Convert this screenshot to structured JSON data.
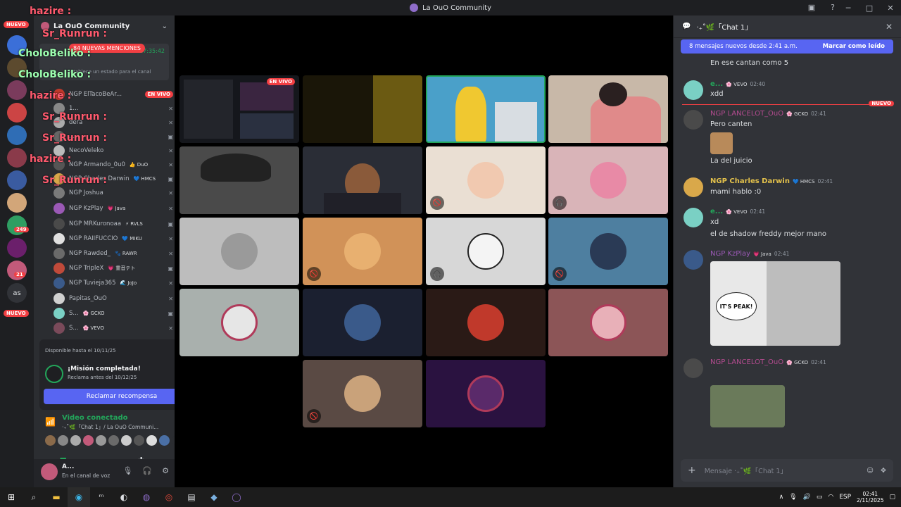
{
  "window": {
    "title": "La OuO Community"
  },
  "overlays": [
    {
      "text": "hazire :",
      "color": "red"
    },
    {
      "text": "Sr_Runrun :",
      "color": "red"
    },
    {
      "text": "CholoBeliko :",
      "color": "green"
    },
    {
      "text": "CholoBeliko :",
      "color": "green"
    },
    {
      "text": "hazire :",
      "color": "red"
    },
    {
      "text": "Sr_Runrun :",
      "color": "red"
    },
    {
      "text": "Sr_Runrun :",
      "color": "red"
    },
    {
      "text": "hazire :",
      "color": "red"
    },
    {
      "text": "Sr_Runrun :",
      "color": "red"
    }
  ],
  "servers": {
    "nuevo_top": "NUEVO",
    "nuevo_bottom": "NUEVO",
    "badge_a": "249",
    "badge_b": "21",
    "text_server": "as"
  },
  "sidebar": {
    "server_name": "La OuO Community",
    "mentions_badge": "84 NUEVAS MENCIONES",
    "stream_time": "17:35:42",
    "stream_sub": "Establece un estado para el canal",
    "users": [
      {
        "name": "NGP ElTacoBeAr...",
        "tag": "",
        "live": "EN VIVO"
      },
      {
        "name": "1...",
        "tag": "",
        "live": ""
      },
      {
        "name": "dera",
        "tag": "",
        "live": ""
      },
      {
        "name": "...",
        "tag": "",
        "live": ""
      },
      {
        "name": "NecoVeleko",
        "tag": "",
        "live": ""
      },
      {
        "name": "NGP Armando_0u0",
        "tag": "👍 DuO",
        "live": ""
      },
      {
        "name": "NGP Charles Darwin",
        "tag": "💙 HMCS",
        "live": ""
      },
      {
        "name": "NGP Joshua",
        "tag": "",
        "live": ""
      },
      {
        "name": "NGP KzPlay",
        "tag": "💗 Java",
        "live": ""
      },
      {
        "name": "NGP MRKuronoaa",
        "tag": "⚡ RVLS",
        "live": ""
      },
      {
        "name": "NGP RAIIFUCCIO",
        "tag": "💙 MIKU",
        "live": ""
      },
      {
        "name": "NGP Rawded_",
        "tag": "🐾 RAWR",
        "live": ""
      },
      {
        "name": "NGP TripleX",
        "tag": "💗 重音テト",
        "live": ""
      },
      {
        "name": "NGP Tuvieja365",
        "tag": "🌊 JoJo",
        "live": ""
      },
      {
        "name": "Papitas_OuO",
        "tag": "",
        "live": ""
      },
      {
        "name": "S...",
        "tag": "🌸 GCKO",
        "live": ""
      },
      {
        "name": "S...",
        "tag": "🌸 VEVO",
        "live": ""
      }
    ]
  },
  "quest": {
    "available": "Disponible hasta el 10/11/25",
    "title": "¡Misión completada!",
    "subtitle": "Reclama antes del 10/12/25",
    "button": "Reclamar recompensa"
  },
  "voice": {
    "status": "Video conectado",
    "channel": "‧₊˚🌿「Chat 1」/ La OuO Communi..."
  },
  "user": {
    "name": "A...",
    "status": "En el canal de voz"
  },
  "stage": {
    "live_badge": "EN VIVO"
  },
  "chat": {
    "header": "‧₊˚🌿「Chat 1」",
    "new_bar": "8 mensajes nuevos desde 2:41 a.m.",
    "mark_read": "Marcar como leído",
    "nuevo": "NUEVO",
    "messages": [
      {
        "author": "",
        "text": "En ese cantan como 5"
      },
      {
        "author": "e...",
        "badge": "🌸 VEVO",
        "time": "02:40",
        "text": "xdd",
        "color": "#23a55a"
      },
      {
        "author": "NGP LANCELOT_OuO",
        "badge": "🌸 GCKO",
        "time": "02:41",
        "text": "Pero canten",
        "text2": "La del juicio",
        "color": "#b34b8f"
      },
      {
        "author": "NGP Charles Darwin",
        "badge": "💙 HMCS",
        "time": "02:41",
        "text": "mami hablo :0",
        "color": "#e3c14b"
      },
      {
        "author": "e...",
        "badge": "🌸 VEVO",
        "time": "02:41",
        "text": "xd",
        "text2": "el de shadow freddy mejor mano",
        "color": "#23a55a"
      },
      {
        "author": "NGP KzPlay",
        "badge": "💗 Java",
        "time": "02:41",
        "text": "",
        "color": "#9b59b6"
      },
      {
        "author": "NGP LANCELOT_OuO",
        "badge": "🌸 GCKO",
        "time": "02:41",
        "text": "",
        "color": "#b34b8f"
      }
    ],
    "image_caption": "IT'S PEAK!",
    "composer_placeholder": "Mensaje ‧₊˚🌿「Chat 1」"
  },
  "taskbar": {
    "lang": "ESP",
    "time": "02:41",
    "date": "2/11/2025"
  }
}
